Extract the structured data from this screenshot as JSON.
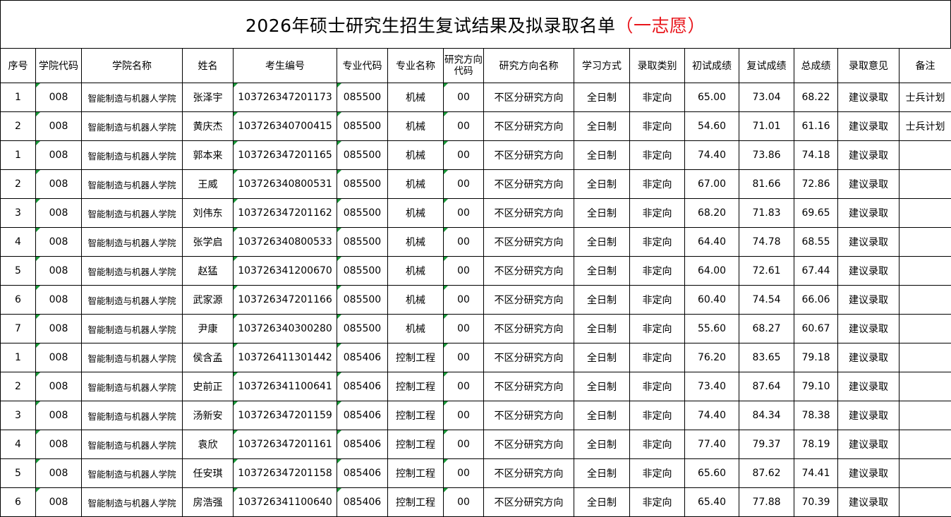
{
  "title": {
    "main": "2026年硕士研究生招生复试结果及拟录取名单",
    "suffix": "（一志愿）"
  },
  "columns": [
    "序号",
    "学院代码",
    "学院名称",
    "姓名",
    "考生编号",
    "专业代码",
    "专业名称",
    "研究方向代码",
    "研究方向名称",
    "学习方式",
    "录取类别",
    "初试成绩",
    "复试成绩",
    "总成绩",
    "录取意见",
    "备注"
  ],
  "rows": [
    [
      "1",
      "008",
      "智能制造与机器人学院",
      "张泽宇",
      "103726347201173",
      "085500",
      "机械",
      "00",
      "不区分研究方向",
      "全日制",
      "非定向",
      "65.00",
      "73.04",
      "68.22",
      "建议录取",
      "士兵计划"
    ],
    [
      "2",
      "008",
      "智能制造与机器人学院",
      "黄庆杰",
      "103726340700415",
      "085500",
      "机械",
      "00",
      "不区分研究方向",
      "全日制",
      "非定向",
      "54.60",
      "71.01",
      "61.16",
      "建议录取",
      "士兵计划"
    ],
    [
      "1",
      "008",
      "智能制造与机器人学院",
      "郭本来",
      "103726347201165",
      "085500",
      "机械",
      "00",
      "不区分研究方向",
      "全日制",
      "非定向",
      "74.40",
      "73.86",
      "74.18",
      "建议录取",
      ""
    ],
    [
      "2",
      "008",
      "智能制造与机器人学院",
      "王威",
      "103726340800531",
      "085500",
      "机械",
      "00",
      "不区分研究方向",
      "全日制",
      "非定向",
      "67.00",
      "81.66",
      "72.86",
      "建议录取",
      ""
    ],
    [
      "3",
      "008",
      "智能制造与机器人学院",
      "刘伟东",
      "103726347201162",
      "085500",
      "机械",
      "00",
      "不区分研究方向",
      "全日制",
      "非定向",
      "68.20",
      "71.83",
      "69.65",
      "建议录取",
      ""
    ],
    [
      "4",
      "008",
      "智能制造与机器人学院",
      "张学启",
      "103726340800533",
      "085500",
      "机械",
      "00",
      "不区分研究方向",
      "全日制",
      "非定向",
      "64.40",
      "74.78",
      "68.55",
      "建议录取",
      ""
    ],
    [
      "5",
      "008",
      "智能制造与机器人学院",
      "赵猛",
      "103726341200670",
      "085500",
      "机械",
      "00",
      "不区分研究方向",
      "全日制",
      "非定向",
      "64.00",
      "72.61",
      "67.44",
      "建议录取",
      ""
    ],
    [
      "6",
      "008",
      "智能制造与机器人学院",
      "武家源",
      "103726347201166",
      "085500",
      "机械",
      "00",
      "不区分研究方向",
      "全日制",
      "非定向",
      "60.40",
      "74.54",
      "66.06",
      "建议录取",
      ""
    ],
    [
      "7",
      "008",
      "智能制造与机器人学院",
      "尹康",
      "103726340300280",
      "085500",
      "机械",
      "00",
      "不区分研究方向",
      "全日制",
      "非定向",
      "55.60",
      "68.27",
      "60.67",
      "建议录取",
      ""
    ],
    [
      "1",
      "008",
      "智能制造与机器人学院",
      "侯含孟",
      "103726411301442",
      "085406",
      "控制工程",
      "00",
      "不区分研究方向",
      "全日制",
      "非定向",
      "76.20",
      "83.65",
      "79.18",
      "建议录取",
      ""
    ],
    [
      "2",
      "008",
      "智能制造与机器人学院",
      "史前正",
      "103726341100641",
      "085406",
      "控制工程",
      "00",
      "不区分研究方向",
      "全日制",
      "非定向",
      "73.40",
      "87.64",
      "79.10",
      "建议录取",
      ""
    ],
    [
      "3",
      "008",
      "智能制造与机器人学院",
      "汤新安",
      "103726347201159",
      "085406",
      "控制工程",
      "00",
      "不区分研究方向",
      "全日制",
      "非定向",
      "74.40",
      "84.34",
      "78.38",
      "建议录取",
      ""
    ],
    [
      "4",
      "008",
      "智能制造与机器人学院",
      "袁欣",
      "103726347201161",
      "085406",
      "控制工程",
      "00",
      "不区分研究方向",
      "全日制",
      "非定向",
      "77.40",
      "79.37",
      "78.19",
      "建议录取",
      ""
    ],
    [
      "5",
      "008",
      "智能制造与机器人学院",
      "任安琪",
      "103726347201158",
      "085406",
      "控制工程",
      "00",
      "不区分研究方向",
      "全日制",
      "非定向",
      "65.60",
      "87.62",
      "74.41",
      "建议录取",
      ""
    ],
    [
      "6",
      "008",
      "智能制造与机器人学院",
      "房浩强",
      "103726341100640",
      "085406",
      "控制工程",
      "00",
      "不区分研究方向",
      "全日制",
      "非定向",
      "65.40",
      "77.88",
      "70.39",
      "建议录取",
      ""
    ]
  ],
  "colors": {
    "title_suffix": "#e8151b",
    "text_cell_marker": "#1a9a3a",
    "grid": "#000000"
  }
}
